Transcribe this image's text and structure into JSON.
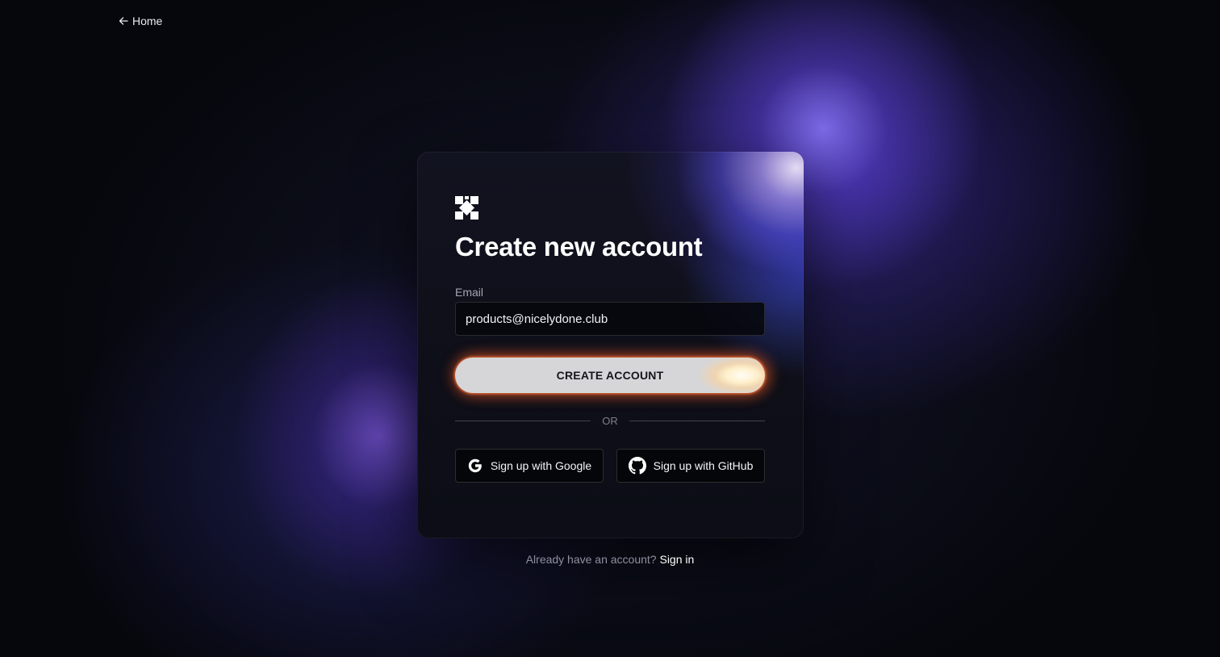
{
  "nav": {
    "back_label": "Home",
    "back_icon": "arrow-left-icon"
  },
  "card": {
    "logo_icon": "brand-logo-icon",
    "title": "Create new account",
    "email": {
      "label": "Email",
      "value": "products@nicelydone.club"
    },
    "submit_label": "CREATE ACCOUNT",
    "divider_text": "OR",
    "social": [
      {
        "label": "Sign up with Google",
        "icon": "google-icon"
      },
      {
        "label": "Sign up with GitHub",
        "icon": "github-icon"
      }
    ]
  },
  "footer": {
    "prompt": "Already have an account?",
    "link_label": "Sign in"
  },
  "colors": {
    "background": "#06070c",
    "accent_purple": "#7b6cf6",
    "button_fill": "#d6d6d8",
    "button_glow": "#ff6a2b"
  }
}
